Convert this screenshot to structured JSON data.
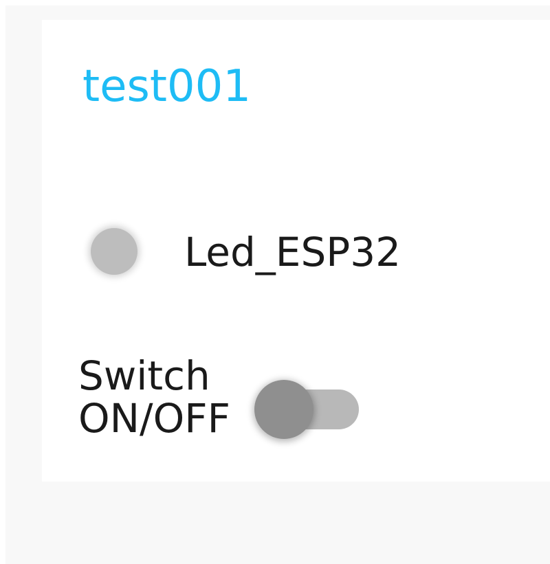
{
  "card": {
    "title": "test001",
    "title_color": "#1ebcf5"
  },
  "led": {
    "label": "Led_ESP32",
    "state": "off",
    "color": "#bdbdbd"
  },
  "switch": {
    "label_line1": "Switch",
    "label_line2": "ON/OFF",
    "state": "off",
    "track_color": "#b8b8b8",
    "knob_color": "#8f8f8f"
  }
}
